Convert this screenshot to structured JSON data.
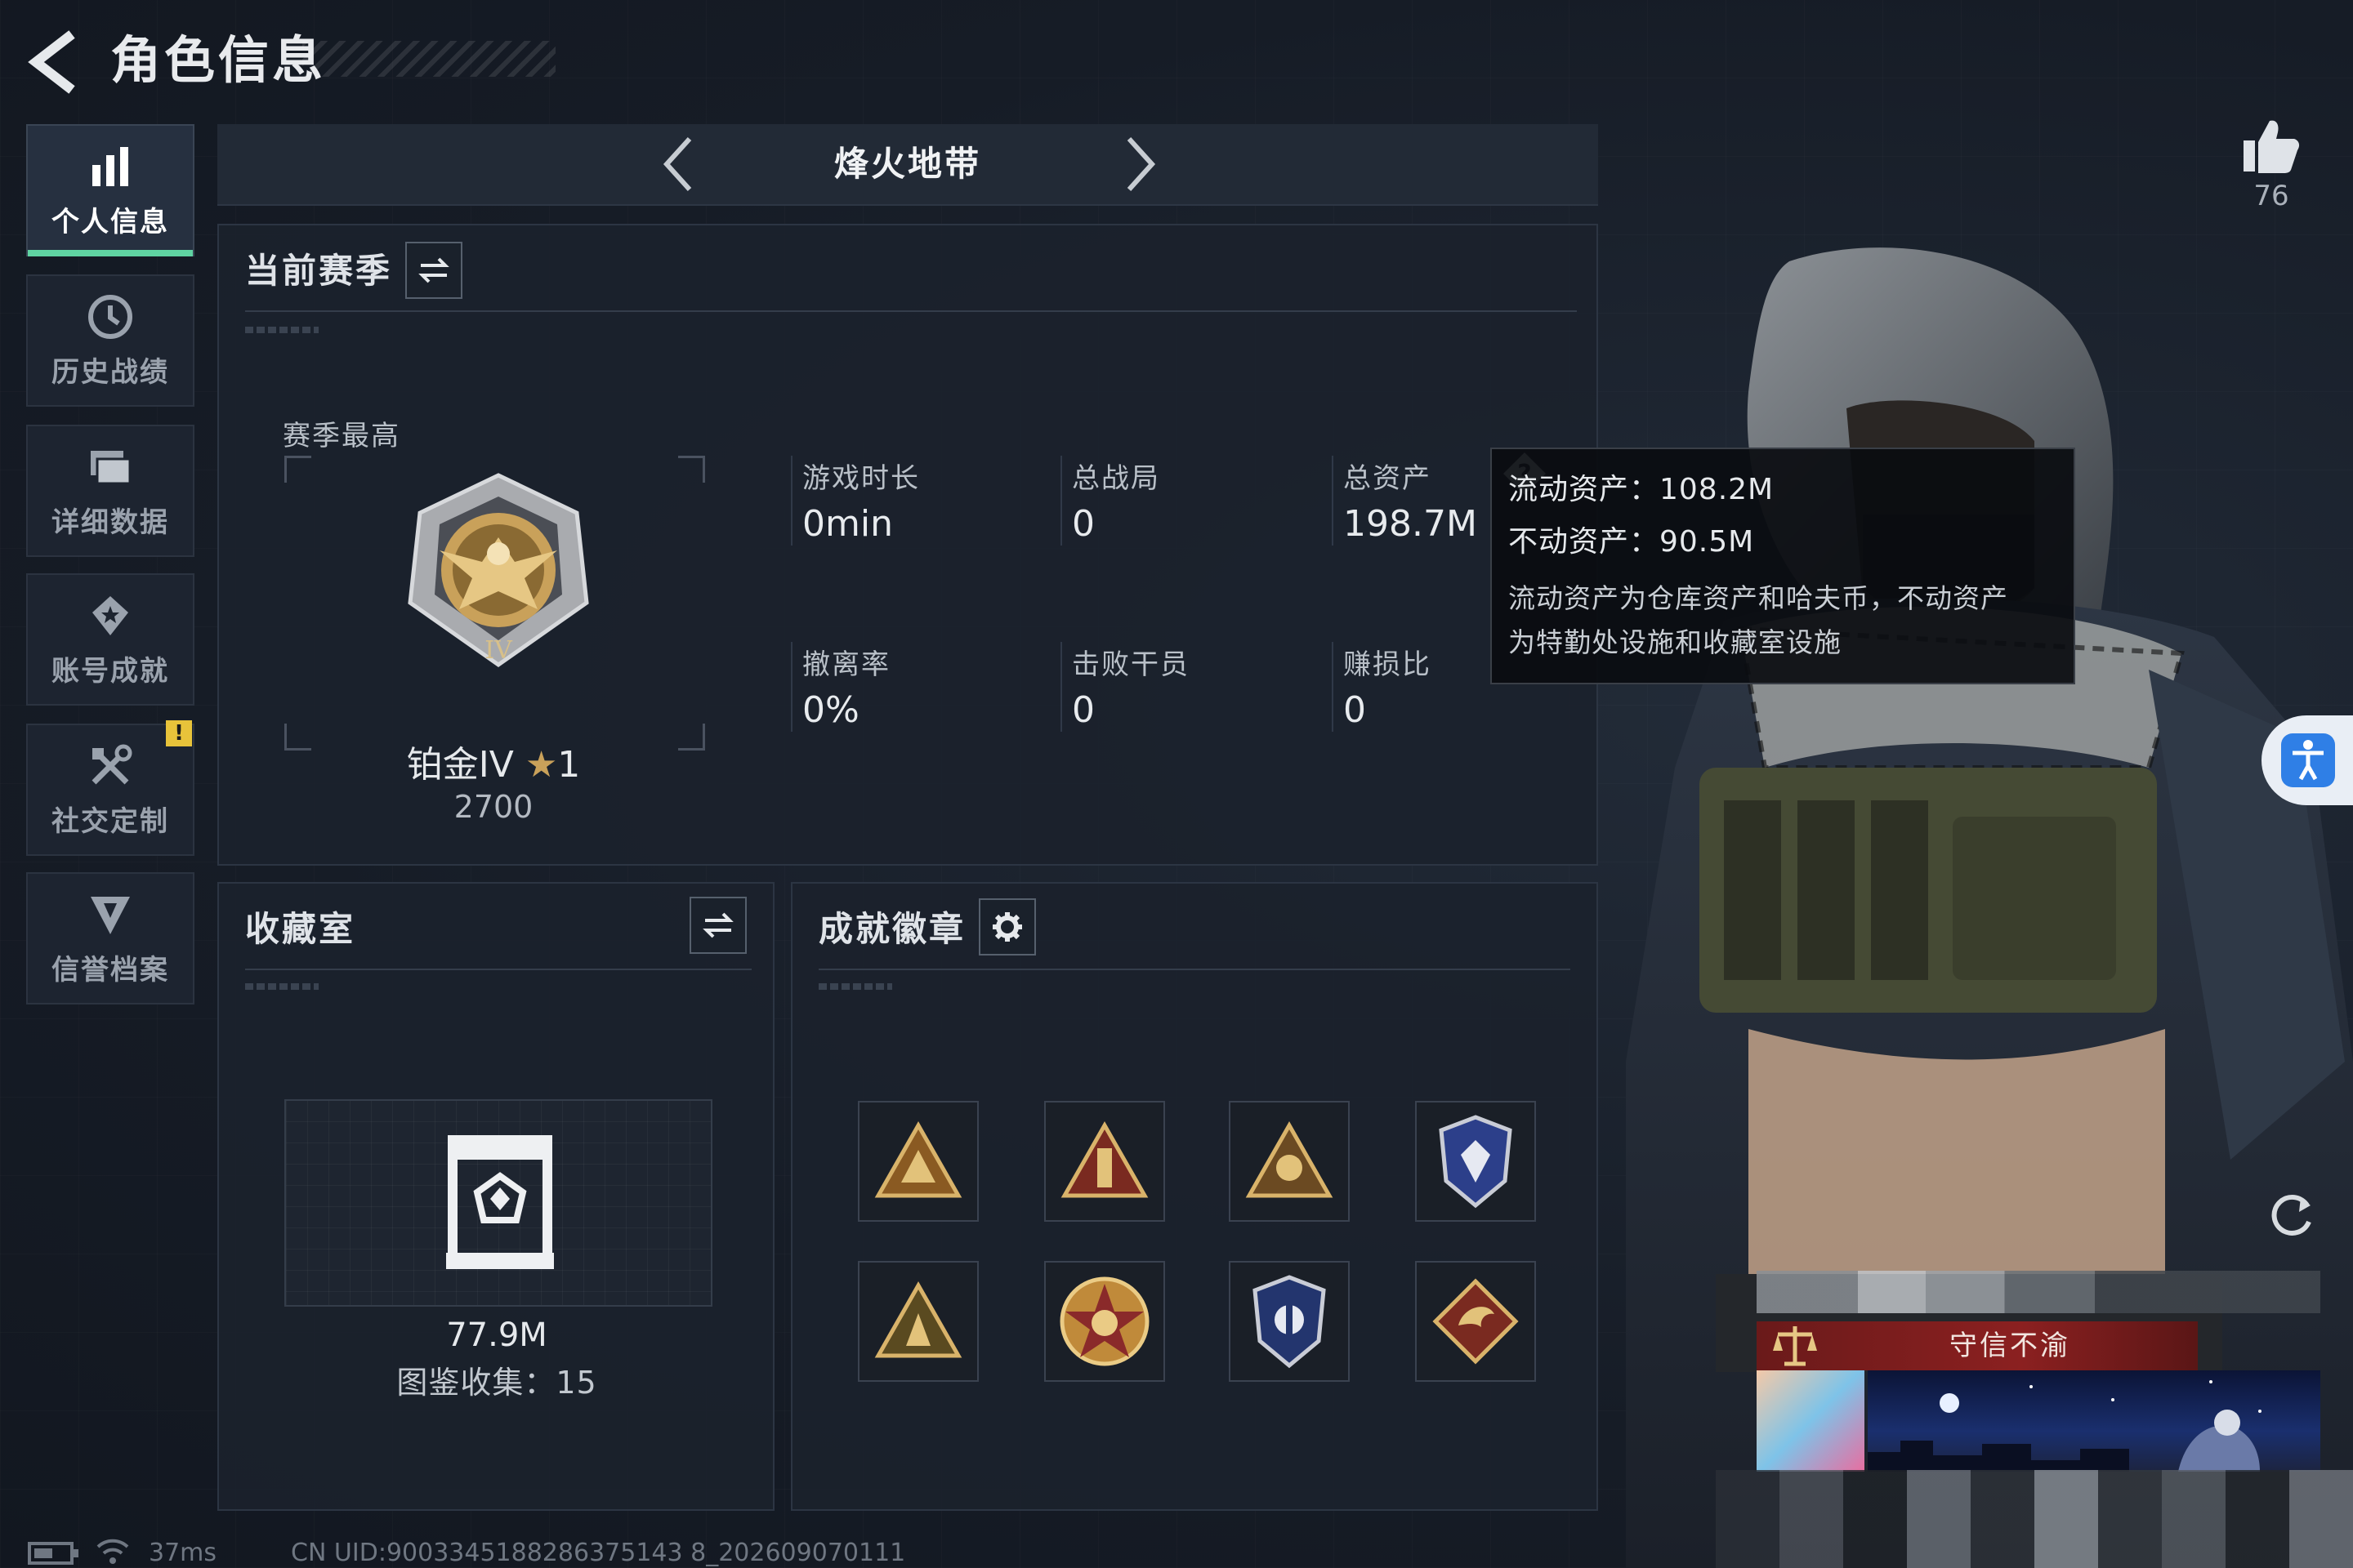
{
  "header": {
    "title": "角色信息"
  },
  "sidebar": {
    "items": [
      {
        "label": "个人信息",
        "icon": "bar-chart-icon",
        "active": true
      },
      {
        "label": "历史战绩",
        "icon": "clock-icon"
      },
      {
        "label": "详细数据",
        "icon": "folder-icon"
      },
      {
        "label": "账号成就",
        "icon": "achievement-icon"
      },
      {
        "label": "社交定制",
        "icon": "tools-icon",
        "badge": "!"
      },
      {
        "label": "信誉档案",
        "icon": "shield-icon"
      }
    ]
  },
  "mode_bar": {
    "title": "烽火地带"
  },
  "season": {
    "title": "当前赛季",
    "rank_caption": "赛季最高",
    "rank_name": "铂金IV",
    "rank_stars": "1",
    "rank_points": "2700",
    "stats": [
      {
        "label": "游戏时长",
        "value": "0min"
      },
      {
        "label": "总战局",
        "value": "0"
      },
      {
        "label": "总资产",
        "value": "198.7M"
      },
      {
        "label": "撤离率",
        "value": "0%"
      },
      {
        "label": "击败干员",
        "value": "0"
      },
      {
        "label": "赚损比",
        "value": "0"
      }
    ]
  },
  "tooltip": {
    "liquid": "流动资产：108.2M",
    "fixed": "不动资产：90.5M",
    "note_line1": "流动资产为仓库资产和哈夫币，不动资产",
    "note_line2": "为特勤处设施和收藏室设施"
  },
  "collection": {
    "title": "收藏室",
    "value": "77.9M",
    "catalog": "图鉴收集：15"
  },
  "achievements": {
    "title": "成就徽章",
    "badges": [
      "triangle-badge-1",
      "triangle-badge-2",
      "triangle-badge-3",
      "shield-badge-1",
      "triangle-badge-4",
      "star-medal-badge",
      "shield-badge-2",
      "dragon-badge"
    ]
  },
  "right": {
    "like_count": "76",
    "honor_title": "守信不渝"
  },
  "footer": {
    "ping": "37ms",
    "uid": "CN UID:9003345188286375143 8_202609070111"
  },
  "colors": {
    "accent_green": "#5fd3a2",
    "warning_yellow": "#e8c33a",
    "honor_red": "#8b2020",
    "access_blue": "#2f7fe6"
  }
}
